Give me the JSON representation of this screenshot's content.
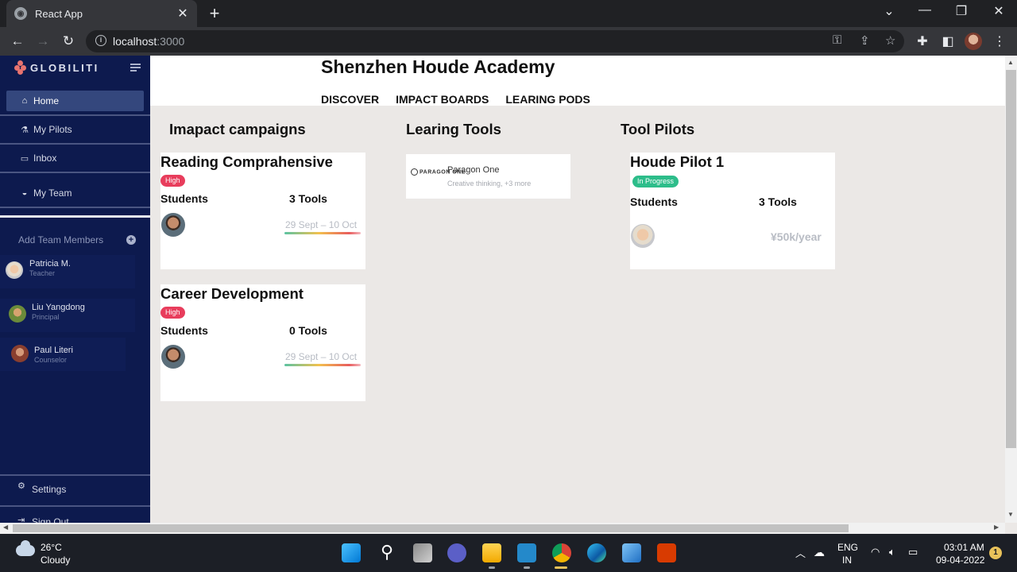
{
  "browser": {
    "tab_title": "React App",
    "url_host": "localhost",
    "url_port": ":3000",
    "new_tab_symbol": "+",
    "close_symbol": "✕"
  },
  "sidebar": {
    "logo_text": "GLOBILITI",
    "items": [
      {
        "label": "Home",
        "icon": "home-icon",
        "active": true
      },
      {
        "label": "My Pilots",
        "icon": "flask-icon"
      },
      {
        "label": "Inbox",
        "icon": "inbox-icon"
      },
      {
        "label": "My Team",
        "icon": "team-icon"
      }
    ],
    "add_team_label": "Add Team Members",
    "members": [
      {
        "name": "Patricia M.",
        "role": "Teacher"
      },
      {
        "name": "Liu Yangdong",
        "role": "Principal"
      },
      {
        "name": "Paul Literi",
        "role": "Counselor"
      }
    ],
    "settings_label": "Settings",
    "signout_label": "Sign Out"
  },
  "header": {
    "title": "Shenzhen Houde Academy",
    "nav": [
      "DISCOVER",
      "IMPACT BOARDS",
      "LEARING PODS"
    ]
  },
  "sections": {
    "campaigns_title": "Imapact campaigns",
    "tools_title": "Learing Tools",
    "pilots_title": "Tool Pilots"
  },
  "campaigns": [
    {
      "title": "Reading Comprahensive",
      "priority": "High",
      "students_label": "Students",
      "tools": "3 Tools",
      "dates": "29 Sept – 10 Oct"
    },
    {
      "title": "Career Development",
      "priority": "High",
      "students_label": "Students",
      "tools": "0 Tools",
      "dates": "29 Sept – 10 Oct"
    }
  ],
  "learning_tools": [
    {
      "logo_text": "PARAGON ONE",
      "name": "Paragon One",
      "subtitle": "Creative thinking, +3 more"
    }
  ],
  "pilots": [
    {
      "title": "Houde Pilot 1",
      "status": "In Progress",
      "students_label": "Students",
      "tools": "3 Tools",
      "price": "¥50k/year"
    }
  ],
  "taskbar": {
    "temperature": "26°C",
    "condition": "Cloudy",
    "lang_line1": "ENG",
    "lang_line2": "IN",
    "time": "03:01 AM",
    "date": "09-04-2022",
    "notification_count": "1"
  },
  "colors": {
    "sidebar_bg": "#0d1a4e",
    "badge_high": "#e83d5c",
    "badge_progress": "#2dbd8a",
    "content_bg": "#ebe8e6"
  }
}
